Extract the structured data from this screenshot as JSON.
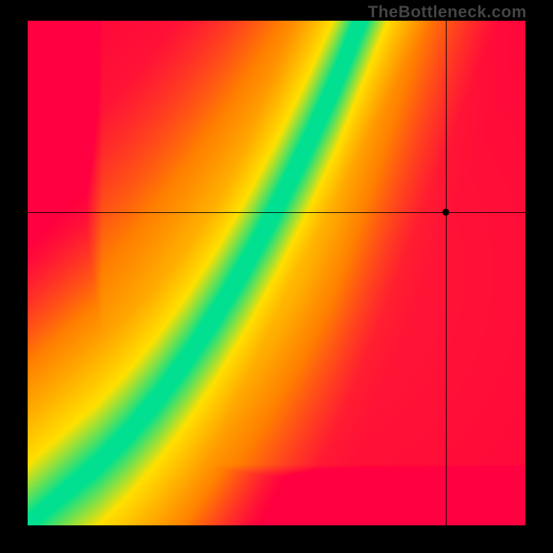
{
  "watermark": "TheBottleneck.com",
  "chart_data": {
    "type": "heatmap",
    "title": "",
    "xlabel": "",
    "ylabel": "",
    "xlim": [
      0,
      100
    ],
    "ylim": [
      0,
      100
    ],
    "crosshair": {
      "x": 84,
      "y": 62
    },
    "marker": {
      "x": 84,
      "y": 62
    },
    "optimal_ridge": {
      "description": "Green ridge indicating balanced pairing; values are (x, y) samples along the curve",
      "points": [
        [
          2,
          2
        ],
        [
          8,
          7
        ],
        [
          14,
          12
        ],
        [
          20,
          18
        ],
        [
          26,
          25
        ],
        [
          32,
          33
        ],
        [
          38,
          42
        ],
        [
          44,
          52
        ],
        [
          50,
          63
        ],
        [
          56,
          75
        ],
        [
          62,
          88
        ],
        [
          66,
          98
        ]
      ]
    },
    "color_scale": {
      "low": "#ff0040",
      "mid_low": "#ff8000",
      "mid": "#ffe000",
      "good": "#00e090",
      "description": "red=poor, yellow=moderate, green=optimal"
    }
  }
}
